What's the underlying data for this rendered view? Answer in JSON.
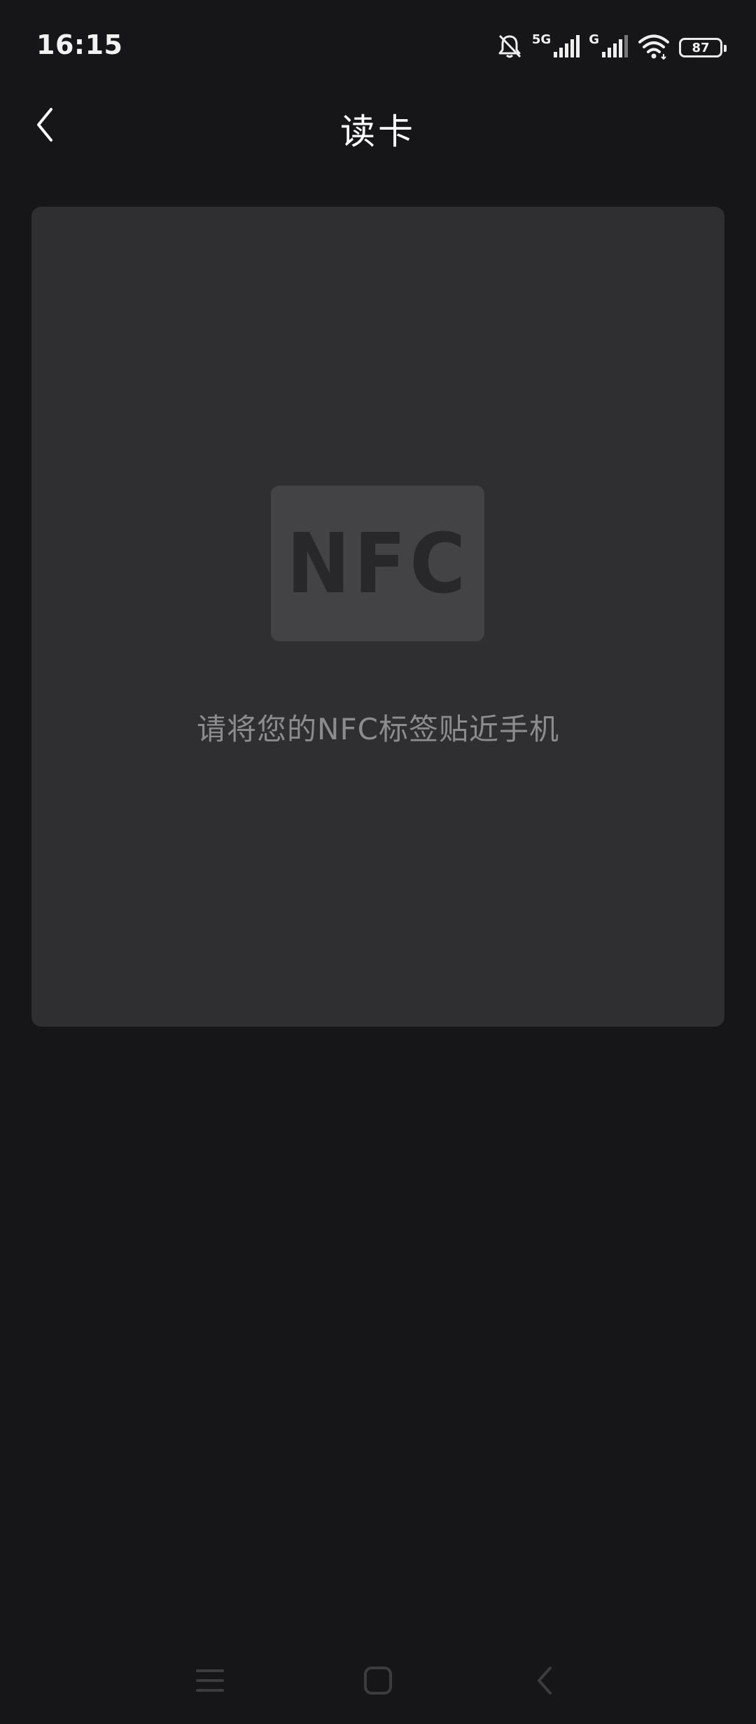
{
  "status_bar": {
    "time": "16:15",
    "network_1": "5G",
    "network_2": "G",
    "battery": "87",
    "icons": [
      "bell-muted-icon",
      "signal-icon",
      "signal-icon",
      "wifi-icon",
      "battery-icon"
    ]
  },
  "app_bar": {
    "title": "读卡",
    "back_icon": "chevron-left-icon"
  },
  "nfc_panel": {
    "badge_text": "NFC",
    "hint": "请将您的NFC标签贴近手机"
  },
  "nav_bar": {
    "icons": [
      "menu-icon",
      "home-icon",
      "back-icon"
    ]
  },
  "colors": {
    "background": "#161618",
    "panel": "#2f2f32",
    "badge": "#434346",
    "badge_text": "#28282b",
    "hint_text": "#8c8c8f",
    "title_text": "#ffffff"
  }
}
